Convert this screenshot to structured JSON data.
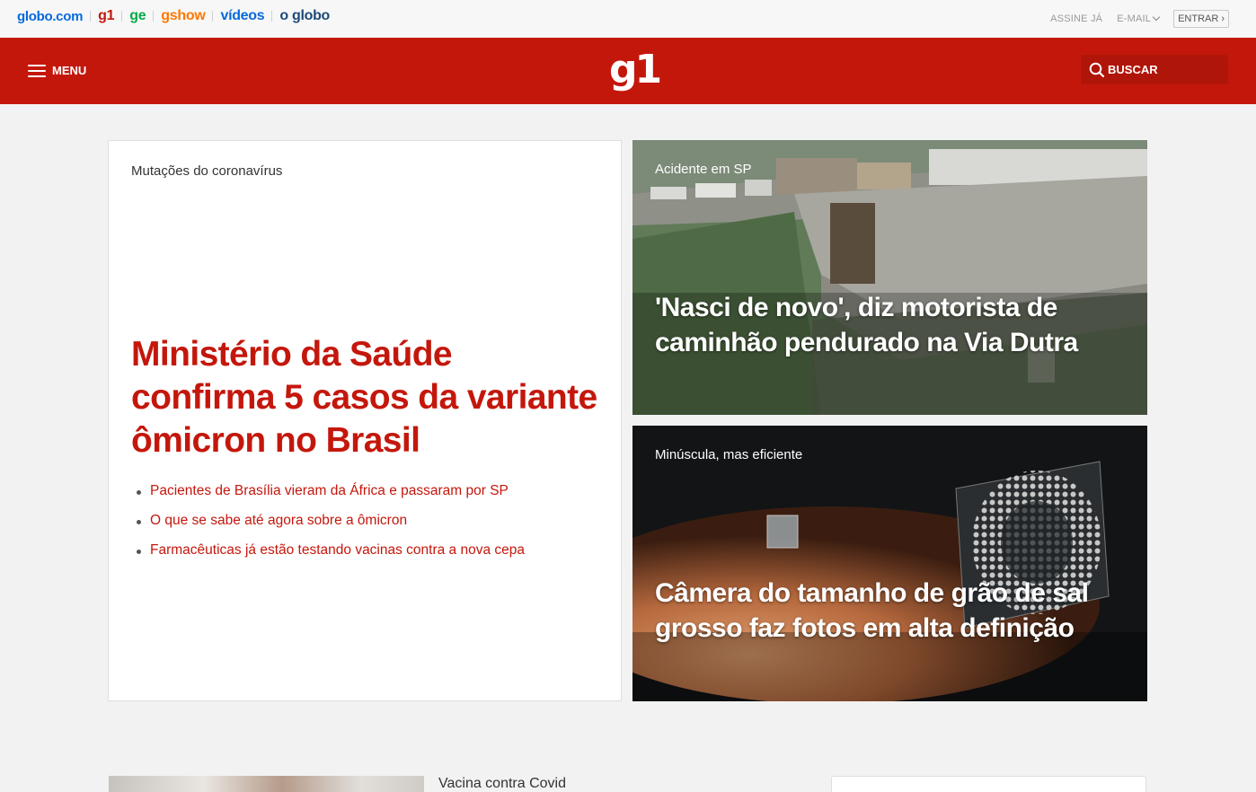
{
  "topbar": {
    "brands": [
      "globo.com",
      "g1",
      "ge",
      "gshow",
      "vídeos",
      "o globo"
    ],
    "assine": "ASSINE JÁ",
    "email": "E-MAIL",
    "entrar": "ENTRAR",
    "entrar_arrow": "›"
  },
  "header": {
    "menu_label": "MENU",
    "logo": "g1",
    "search_label": "BUSCAR",
    "color": "#c4170c"
  },
  "main": {
    "chapeu": "Mutações do coronavírus",
    "headline": "Ministério da Saúde confirma 5 casos da variante ômicron no Brasil",
    "related": [
      "Pacientes de Brasília vieram da África e passaram por SP",
      "O que se sabe até agora sobre a ômicron",
      "Farmacêuticas já estão testando vacinas contra a nova cepa"
    ]
  },
  "cards": [
    {
      "chapeu": "Acidente em SP",
      "title": "'Nasci de novo', diz motorista de caminhão pendurado na Via Dutra"
    },
    {
      "chapeu": "Minúscula, mas eficiente",
      "title": "Câmera do tamanho de grão de sal grosso faz fotos em alta definição"
    }
  ],
  "lower": {
    "chapeu": "Vacina contra Covid"
  }
}
